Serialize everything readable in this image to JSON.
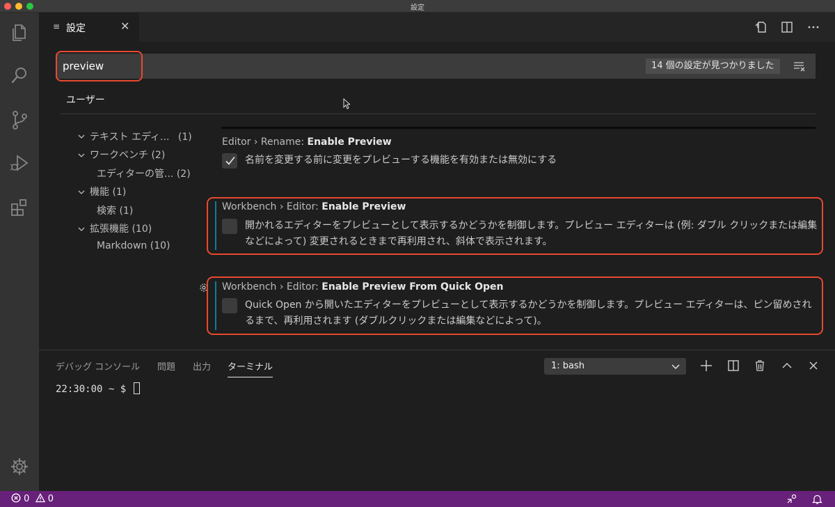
{
  "window": {
    "title": "設定"
  },
  "activity_bar": {
    "items": [
      {
        "name": "explorer-icon"
      },
      {
        "name": "search-icon"
      },
      {
        "name": "source-control-icon"
      },
      {
        "name": "run-debug-icon"
      },
      {
        "name": "extensions-icon"
      }
    ],
    "manage_icon": "gear-icon"
  },
  "editor_tab": {
    "label": "設定",
    "icon": "settings-file-icon",
    "close": "✕"
  },
  "search": {
    "value": "preview",
    "result_count": "14 個の設定が見つかりました"
  },
  "scope": {
    "user_tab": "ユーザー"
  },
  "toc": [
    {
      "label": "テキスト エディ...",
      "count": "(1)",
      "expanded": true
    },
    {
      "label": "ワークベンチ",
      "count": "(2)",
      "expanded": true
    },
    {
      "label": "エディターの管...",
      "count": "(2)",
      "expanded": false
    },
    {
      "label": "機能",
      "count": "(1)",
      "expanded": true
    },
    {
      "label": "検索",
      "count": "(1)",
      "expanded": false
    },
    {
      "label": "拡張機能",
      "count": "(10)",
      "expanded": true
    },
    {
      "label": "Markdown",
      "count": "(10)",
      "expanded": false
    }
  ],
  "settings": [
    {
      "category": "Editor › Rename: ",
      "name": "Enable Preview",
      "description": "名前を変更する前に変更をプレビューする機能を有効または無効にする",
      "checked": true
    },
    {
      "category": "Workbench › Editor: ",
      "name": "Enable Preview",
      "description": "開かれるエディターをプレビューとして表示するかどうかを制御します。プレビュー エディターは (例: ダブル クリックまたは編集などによって) 変更されるときまで再利用され、斜体で表示されます。",
      "checked": false
    },
    {
      "category": "Workbench › Editor: ",
      "name": "Enable Preview From Quick Open",
      "description": "Quick Open から開いたエディターをプレビューとして表示するかどうかを制御します。プレビュー エディターは、ピン留めされるまで、再利用されます (ダブルクリックまたは編集などによって)。",
      "checked": false
    }
  ],
  "panel": {
    "tabs": [
      "デバッグ コンソール",
      "問題",
      "出力",
      "ターミナル"
    ],
    "active_tab": "ターミナル",
    "terminal_select": "1: bash",
    "prompt": "22:30:00 ~ $ "
  },
  "status": {
    "errors": "0",
    "warnings": "0"
  },
  "colors": {
    "status_bar": "#68217a",
    "highlight": "#e8492f",
    "modified_indicator": "#0c7d9d"
  }
}
